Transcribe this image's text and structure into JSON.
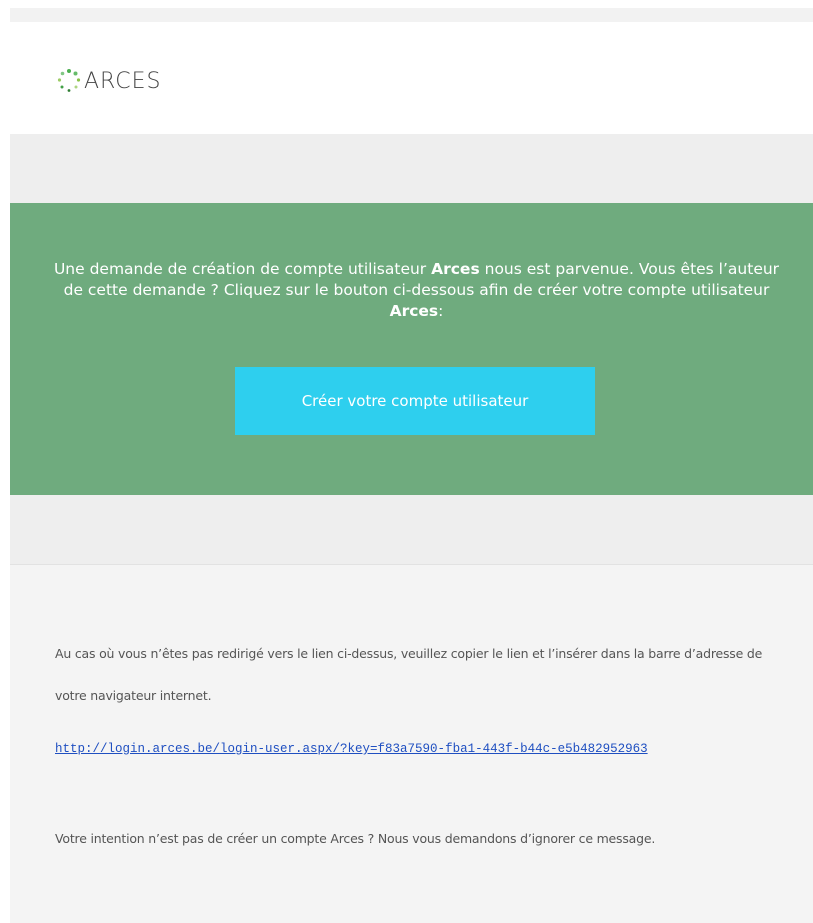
{
  "logo": {
    "text": "ARCES",
    "dot_color": "#4caf50"
  },
  "hero": {
    "line_a": "Une demande de création de compte utilisateur ",
    "brand1": "Arces",
    "line_b": " nous est parvenue. Vous êtes l’auteur de cette demande ? Cliquez sur le bouton ci-dessous afin de créer votre compte utilisateur ",
    "brand2": "Arces",
    "line_c": ":",
    "button_label": "Créer votre compte utilisateur",
    "background_color": "#6fab7e",
    "button_color": "#2ecfee"
  },
  "footer": {
    "redirect_text": "Au cas où vous n’êtes pas redirigé vers le lien ci-dessus, veuillez copier le lien et l’insérer dans la barre d’adresse de votre navigateur internet.",
    "link_text": "http://login.arces.be/login-user.aspx/?key=f83a7590-fba1-443f-b44c-e5b482952963",
    "ignore_text": "Votre intention n’est pas de créer un compte Arces ? Nous vous demandons d’ignorer ce message."
  }
}
